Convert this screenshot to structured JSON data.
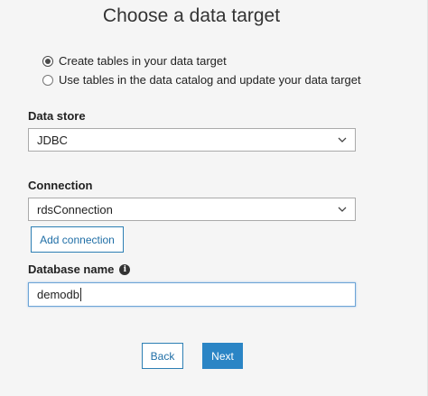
{
  "title": "Choose a data target",
  "target_options": [
    {
      "label": "Create tables in your data target",
      "selected": true
    },
    {
      "label": "Use tables in the data catalog and update your data target",
      "selected": false
    }
  ],
  "data_store": {
    "label": "Data store",
    "value": "JDBC"
  },
  "connection": {
    "label": "Connection",
    "value": "rdsConnection",
    "add_label": "Add connection"
  },
  "database": {
    "label": "Database name",
    "value": "demodb",
    "info_icon": "info-icon"
  },
  "footer": {
    "back_label": "Back",
    "next_label": "Next"
  },
  "colors": {
    "accent": "#2b85c5",
    "link": "#1f6ea6"
  }
}
